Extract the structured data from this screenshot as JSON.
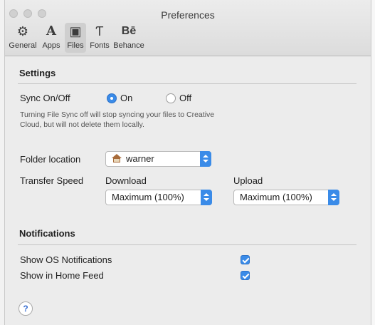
{
  "window": {
    "title": "Preferences"
  },
  "toolbar": {
    "tabs": [
      {
        "label": "General",
        "icon": "gear-icon"
      },
      {
        "label": "Apps",
        "icon": "adobe-icon"
      },
      {
        "label": "Files",
        "icon": "creative-cloud-folder-icon",
        "active": true
      },
      {
        "label": "Fonts",
        "icon": "font-icon"
      },
      {
        "label": "Behance",
        "icon": "behance-icon"
      }
    ],
    "icon_glyphs": {
      "general": "⚙",
      "apps": "A",
      "files": "▣",
      "fonts": "Ƭ",
      "behance": "Bē"
    }
  },
  "settings": {
    "title": "Settings",
    "sync_label": "Sync On/Off",
    "sync_on_label": "On",
    "sync_off_label": "Off",
    "sync_selected": "On",
    "note": "Turning File Sync off will stop syncing your files to Creative Cloud, but will not delete them locally.",
    "folder_label": "Folder location",
    "folder_value": "warner",
    "transfer_label": "Transfer Speed",
    "download_label": "Download",
    "download_value": "Maximum (100%)",
    "upload_label": "Upload",
    "upload_value": "Maximum (100%)"
  },
  "notifications": {
    "title": "Notifications",
    "items": [
      {
        "label": "Show OS Notifications",
        "checked": true
      },
      {
        "label": "Show in Home Feed",
        "checked": true
      }
    ]
  },
  "help": {
    "glyph": "?"
  },
  "colors": {
    "accent": "#3a8be8",
    "window_bg": "#ececec"
  }
}
